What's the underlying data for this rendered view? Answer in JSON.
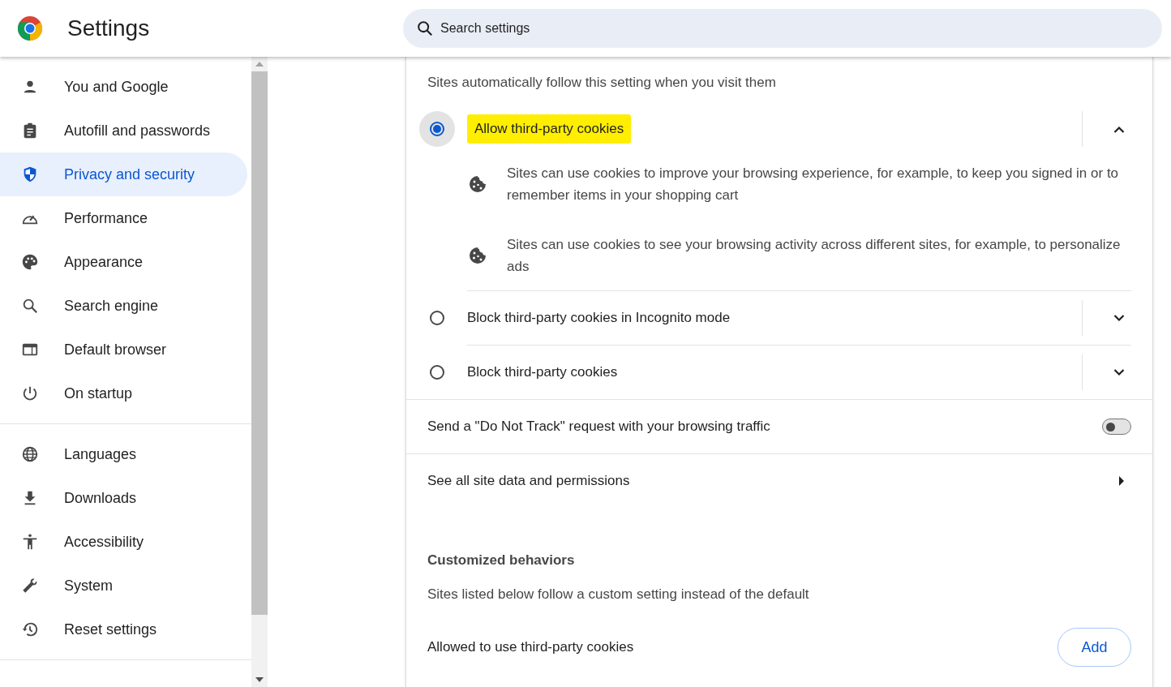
{
  "header": {
    "title": "Settings",
    "search": {
      "placeholder": "Search settings"
    }
  },
  "sidebar": {
    "groups": [
      {
        "items": [
          {
            "label": "You and Google",
            "selected": false
          },
          {
            "label": "Autofill and passwords",
            "selected": false
          },
          {
            "label": "Privacy and security",
            "selected": true
          },
          {
            "label": "Performance",
            "selected": false
          },
          {
            "label": "Appearance",
            "selected": false
          },
          {
            "label": "Search engine",
            "selected": false
          },
          {
            "label": "Default browser",
            "selected": false
          },
          {
            "label": "On startup",
            "selected": false
          }
        ]
      },
      {
        "items": [
          {
            "label": "Languages",
            "selected": false
          },
          {
            "label": "Downloads",
            "selected": false
          },
          {
            "label": "Accessibility",
            "selected": false
          },
          {
            "label": "System",
            "selected": false
          },
          {
            "label": "Reset settings",
            "selected": false
          }
        ]
      }
    ]
  },
  "content": {
    "intro": "Sites automatically follow this setting when you visit them",
    "options": [
      {
        "label": "Allow third-party cookies",
        "selected": true,
        "expanded": true,
        "highlighted": true,
        "details": [
          "Sites can use cookies to improve your browsing experience, for example, to keep you signed in or to remember items in your shopping cart",
          "Sites can use cookies to see your browsing activity across different sites, for example, to personalize ads"
        ]
      },
      {
        "label": "Block third-party cookies in Incognito mode",
        "selected": false,
        "expanded": false,
        "highlighted": false
      },
      {
        "label": "Block third-party cookies",
        "selected": false,
        "expanded": false,
        "highlighted": false
      }
    ],
    "do_not_track": {
      "label": "Send a \"Do Not Track\" request with your browsing traffic",
      "on": false
    },
    "site_data_link": "See all site data and permissions",
    "customized": {
      "heading": "Customized behaviors",
      "description": "Sites listed below follow a custom setting instead of the default",
      "allowed": {
        "label": "Allowed to use third-party cookies",
        "button": "Add"
      }
    }
  }
}
